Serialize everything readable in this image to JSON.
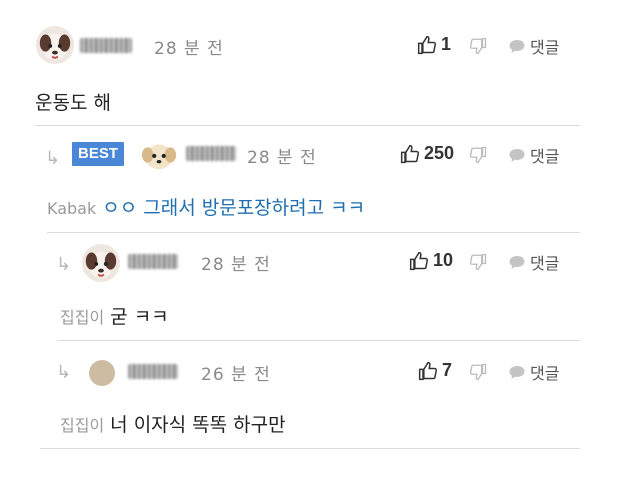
{
  "comments": [
    {
      "time": "28 분 전",
      "likes": "1",
      "reply_label": "댓글",
      "body": "운동도 해"
    },
    {
      "badge": "BEST",
      "time": "28 분 전",
      "likes": "250",
      "reply_label": "댓글",
      "mention": "Kabak",
      "body": "ㅇㅇ 그래서 방문포장하려고 ㅋㅋ"
    },
    {
      "time": "28 분 전",
      "likes": "10",
      "reply_label": "댓글",
      "mention": "집집이",
      "body": "굳 ㅋㅋ"
    },
    {
      "time": "26 분 전",
      "likes": "7",
      "reply_label": "댓글",
      "mention": "집집이",
      "body": "너 이자식 똑똑 하구만"
    }
  ],
  "icons": {
    "like": "thumbs-up-icon",
    "dislike": "thumbs-down-icon",
    "reply": "speech-bubble-icon",
    "reply_indent": "reply-arrow-icon"
  },
  "colors": {
    "best_badge": "#4a87d6",
    "mention_text": "#1f6fb0",
    "divider": "#dcdcdc"
  }
}
